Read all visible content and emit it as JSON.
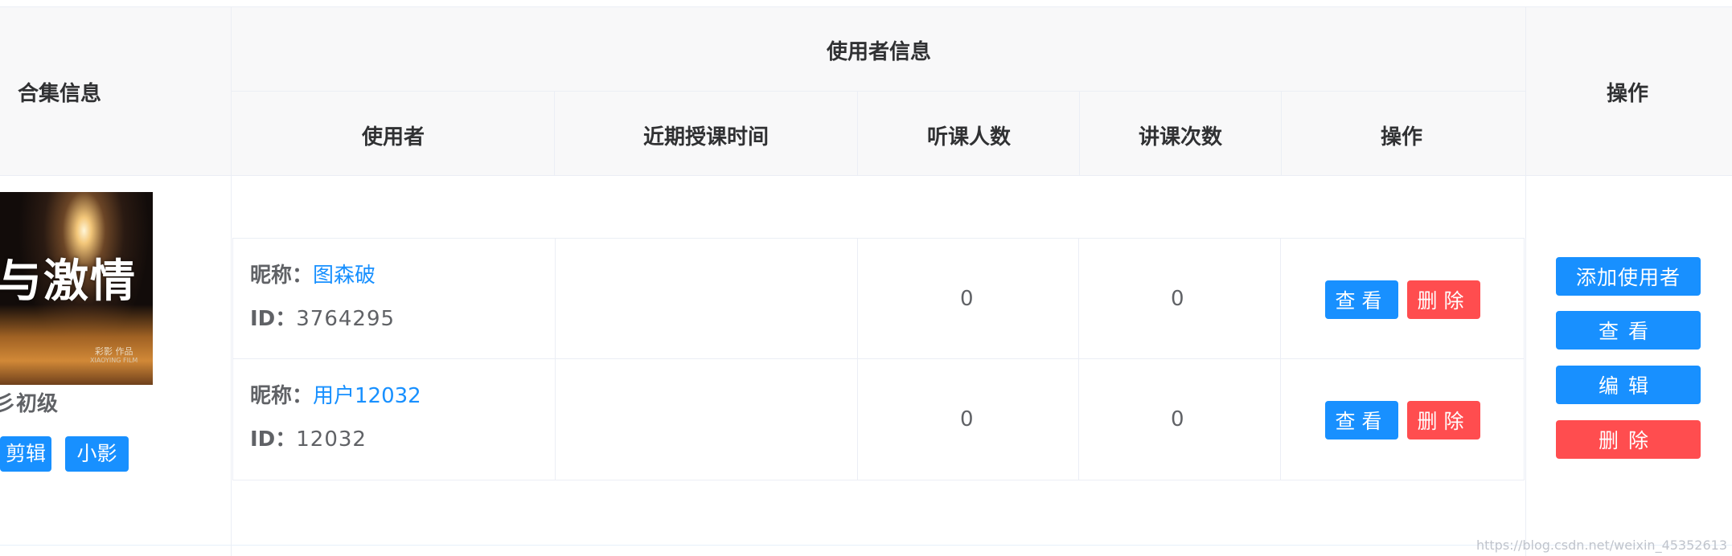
{
  "header": {
    "collection_info": "合集信息",
    "user_info_group": "使用者信息",
    "columns": [
      "使用者",
      "近期授课时间",
      "听课人数",
      "讲课次数",
      "操作"
    ],
    "operations": "操作"
  },
  "collection": {
    "cover_title": "与激情",
    "cover_small_text": "彩影 作品",
    "cover_smaller_text": "XIAOYING FILM",
    "name": "彡初级",
    "tags": [
      "剪辑",
      "小影"
    ]
  },
  "users": [
    {
      "nickname_label": "昵称：",
      "nickname": "图森破",
      "id_label": "ID：",
      "id": "3764295",
      "recent_time": "",
      "listeners": "0",
      "lectures": "0",
      "view_label": "查看",
      "delete_label": "删除"
    },
    {
      "nickname_label": "昵称：",
      "nickname": "用户12032",
      "id_label": "ID：",
      "id": "12032",
      "recent_time": "",
      "listeners": "0",
      "lectures": "0",
      "view_label": "查看",
      "delete_label": "删除"
    }
  ],
  "actions": {
    "add_user": "添加使用者",
    "view": "查看",
    "edit": "编辑",
    "delete": "删除"
  },
  "watermark": "https://blog.csdn.net/weixin_45352613",
  "colors": {
    "primary": "#1890ff",
    "danger": "#ff4d4f",
    "header_bg": "#f8f8f9",
    "border": "#ebeef5"
  }
}
